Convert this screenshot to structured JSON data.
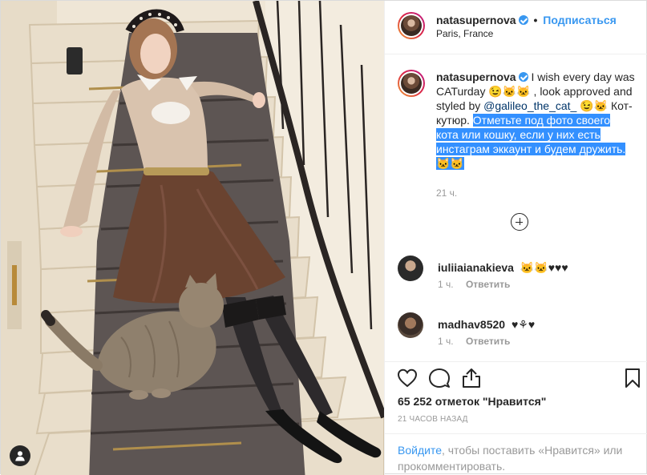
{
  "header": {
    "username": "natasupernova",
    "separator": "•",
    "follow_label": "Подписаться",
    "location": "Paris, France"
  },
  "caption": {
    "username": "natasupernova",
    "text_part1": "I wish every day was CATurday 😉🐱🐱 , look approved and styled by",
    "mention": "@galileo_the_cat_",
    "text_part2": "😉🐱 Кот-кутюр.",
    "text_highlighted": "Отметьте под фото своего кота или кошку, если у них есть инстаграм эккаунт и будем дружить. 🐱🐱",
    "time": "21 ч."
  },
  "comments": [
    {
      "username": "iuliiaianakieva",
      "text": "🐱🐱♥♥♥",
      "time": "1 ч.",
      "reply_label": "Ответить"
    },
    {
      "username": "madhav8520",
      "text": "♥⚘♥",
      "time": "1 ч.",
      "reply_label": "Ответить"
    }
  ],
  "stats": {
    "likes": "65 252 отметок \"Нравится\"",
    "timestamp": "21 ЧАСОВ НАЗАД"
  },
  "login_prompt": {
    "link": "Войдите",
    "text": ", чтобы поставить «Нравится» или прокомментировать."
  },
  "icons": {
    "like": "heart-icon",
    "comment": "comment-icon",
    "share": "share-icon",
    "save": "bookmark-icon",
    "load_more": "plus-circle-icon",
    "user_tag": "user-tag-icon"
  },
  "colors": {
    "link_blue": "#3897f0",
    "selection": "#3390ff",
    "muted": "#999999"
  }
}
